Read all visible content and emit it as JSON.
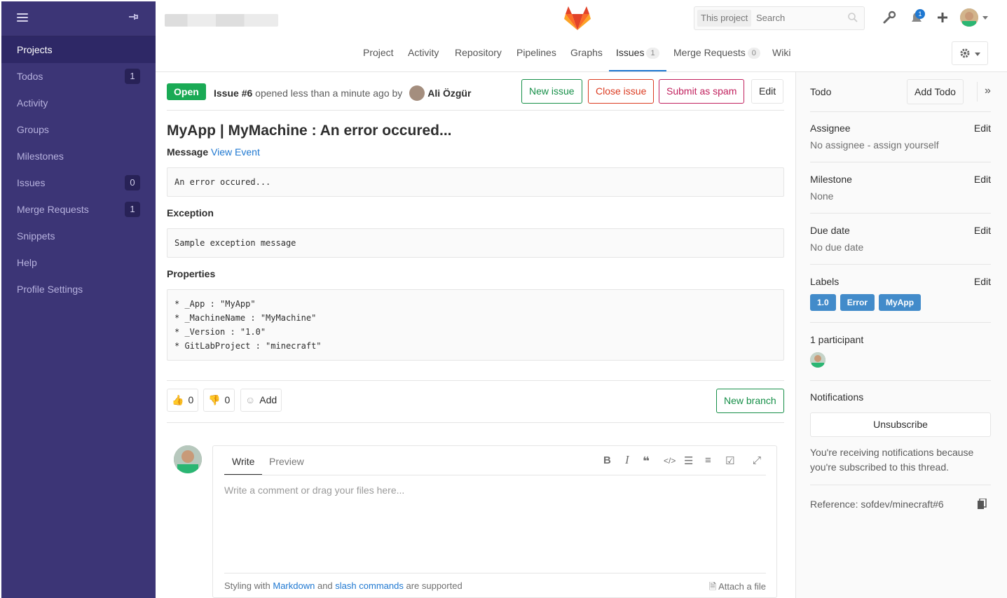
{
  "sidebar": {
    "items": [
      {
        "label": "Projects",
        "badge": ""
      },
      {
        "label": "Todos",
        "badge": "1"
      },
      {
        "label": "Activity",
        "badge": ""
      },
      {
        "label": "Groups",
        "badge": ""
      },
      {
        "label": "Milestones",
        "badge": ""
      },
      {
        "label": "Issues",
        "badge": "0"
      },
      {
        "label": "Merge Requests",
        "badge": "1"
      },
      {
        "label": "Snippets",
        "badge": ""
      },
      {
        "label": "Help",
        "badge": ""
      },
      {
        "label": "Profile Settings",
        "badge": ""
      }
    ]
  },
  "header": {
    "search_scope": "This project",
    "search_placeholder": "Search",
    "todos_count": "1",
    "nav": [
      {
        "label": "Project",
        "badge": ""
      },
      {
        "label": "Activity",
        "badge": ""
      },
      {
        "label": "Repository",
        "badge": ""
      },
      {
        "label": "Pipelines",
        "badge": ""
      },
      {
        "label": "Graphs",
        "badge": ""
      },
      {
        "label": "Issues",
        "badge": "1"
      },
      {
        "label": "Merge Requests",
        "badge": "0"
      },
      {
        "label": "Wiki",
        "badge": ""
      }
    ]
  },
  "issue": {
    "status": "Open",
    "number": "Issue #6",
    "opened_text": "opened less than a minute ago by",
    "author": "Ali Özgür",
    "buttons": {
      "new_issue": "New issue",
      "close_issue": "Close issue",
      "submit_spam": "Submit as spam",
      "edit": "Edit"
    },
    "title": "MyApp | MyMachine : An error occured...",
    "message_label": "Message",
    "view_event": "View Event",
    "message_text": "An error occured...",
    "exception_label": "Exception",
    "exception_text": "Sample exception message",
    "properties_label": "Properties",
    "properties": [
      "* _App : \"MyApp\"",
      "* _MachineName : \"MyMachine\"",
      "* _Version : \"1.0\"",
      "* GitLabProject : \"minecraft\""
    ]
  },
  "awards": {
    "thumbs_up": "0",
    "thumbs_down": "0",
    "add_label": "Add",
    "new_branch": "New branch"
  },
  "comment": {
    "tab_write": "Write",
    "tab_preview": "Preview",
    "placeholder": "Write a comment or drag your files here...",
    "footer_prefix": "Styling with",
    "footer_markdown": "Markdown",
    "footer_and": "and",
    "footer_slash": "slash commands",
    "footer_suffix": "are supported",
    "attach": "Attach a file"
  },
  "right": {
    "todo_label": "Todo",
    "add_todo": "Add Todo",
    "assignee_label": "Assignee",
    "assignee_value": "No assignee - assign yourself",
    "milestone_label": "Milestone",
    "milestone_value": "None",
    "due_label": "Due date",
    "due_value": "No due date",
    "labels_label": "Labels",
    "labels": [
      "1.0",
      "Error",
      "MyApp"
    ],
    "edit": "Edit",
    "participants_label": "1 participant",
    "notifications_label": "Notifications",
    "unsubscribe": "Unsubscribe",
    "notifications_text": "You're receiving notifications because you're subscribed to this thread.",
    "reference": "Reference: sofdev/minecraft#6"
  },
  "colors": {
    "sidebar": "#3c3576",
    "open": "#1aaa55",
    "link": "#1f78d1",
    "label": "#428bca"
  }
}
